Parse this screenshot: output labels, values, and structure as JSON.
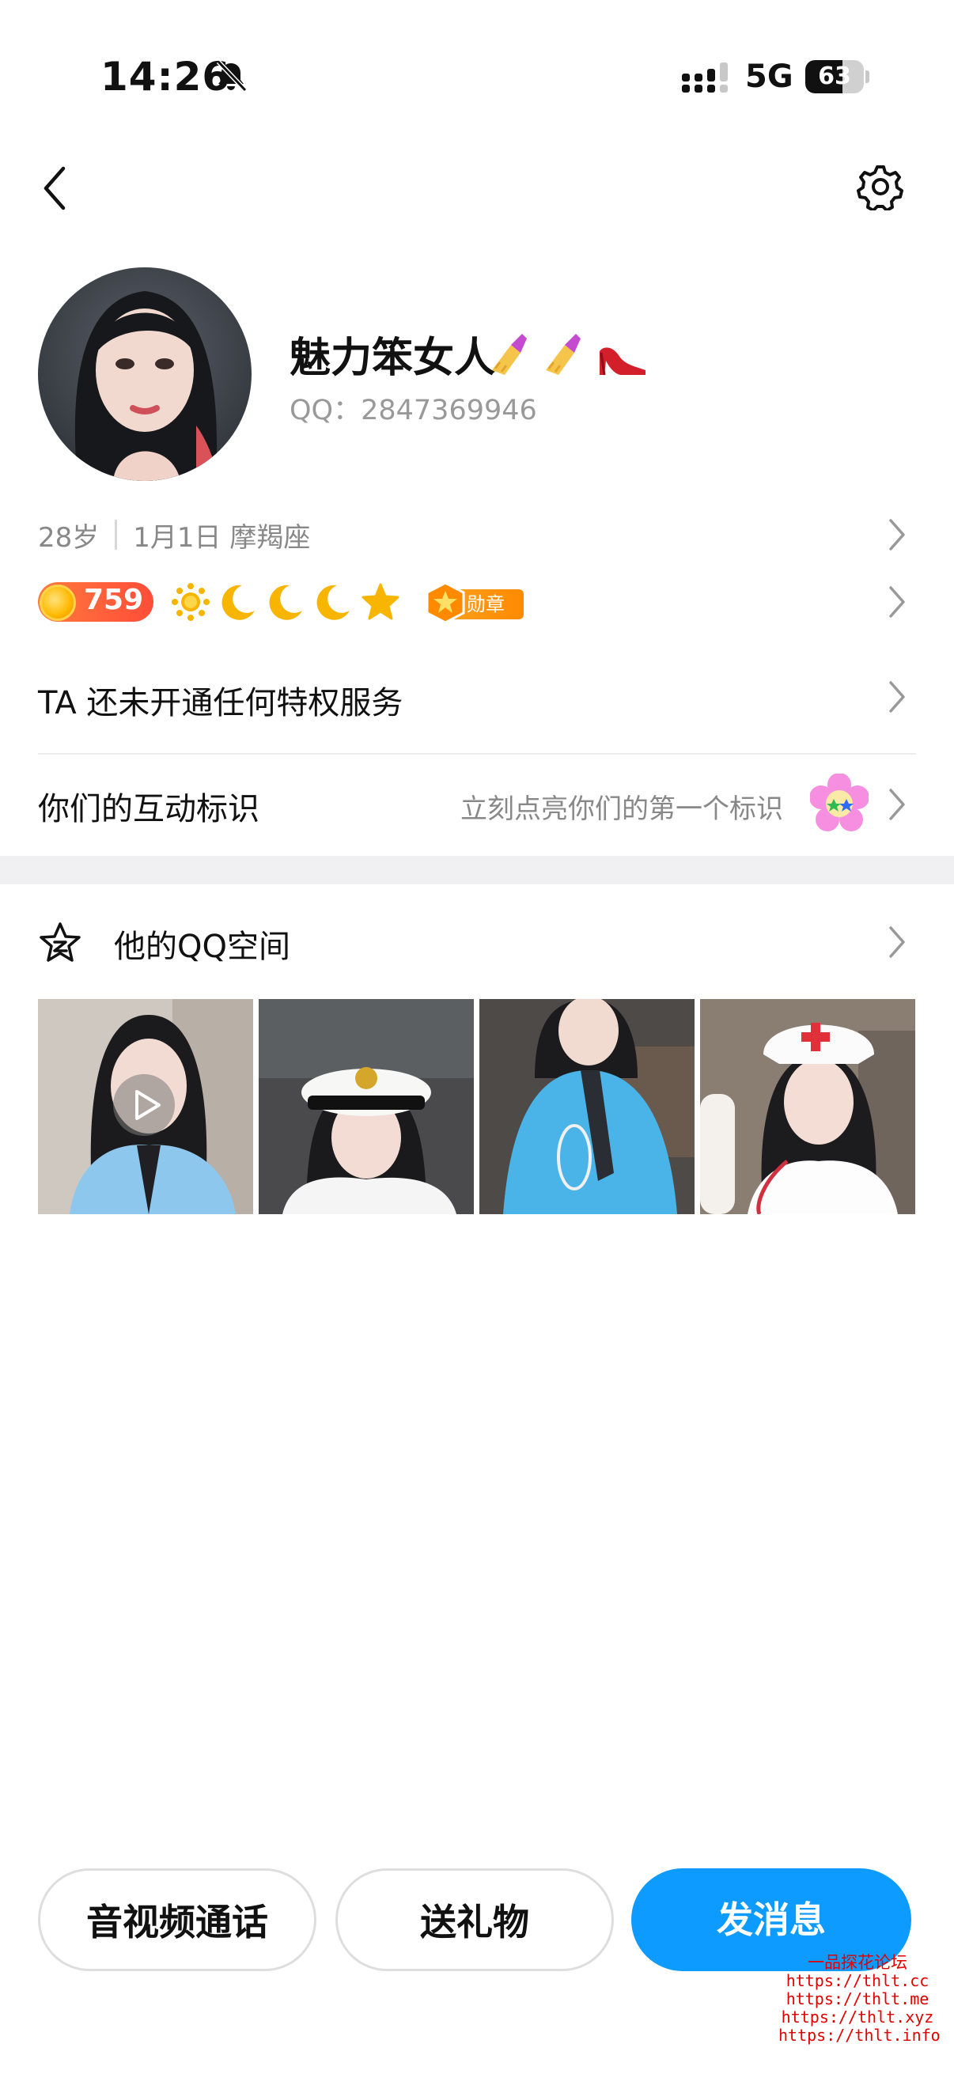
{
  "status_bar": {
    "time": "14:26",
    "network": "5G",
    "battery": "63",
    "battery_level": 0.63
  },
  "profile": {
    "nickname": "魅力笨女人",
    "qq_number": "QQ：2847369946",
    "age": "28岁",
    "birthday": "1月1日 摩羯座",
    "level": "759",
    "medal_label": "勋章"
  },
  "rows": {
    "privilege": "TA 还未开通任何特权服务",
    "interaction_title": "你们的互动标识",
    "interaction_hint": "立刻点亮你们的第一个标识"
  },
  "zone": {
    "title": "他的QQ空间"
  },
  "actions": {
    "call": "音视频通话",
    "gift": "送礼物",
    "message": "发消息"
  },
  "watermark": {
    "title": "一品探花论坛",
    "links": [
      "https://thlt.cc",
      "https://thlt.me",
      "https://thlt.xyz",
      "https://thlt.info"
    ]
  },
  "colors": {
    "accent": "#0d9bff",
    "level_badge": "#ff5a3a",
    "medal": "#ff8a00",
    "watermark": "#e00000"
  }
}
